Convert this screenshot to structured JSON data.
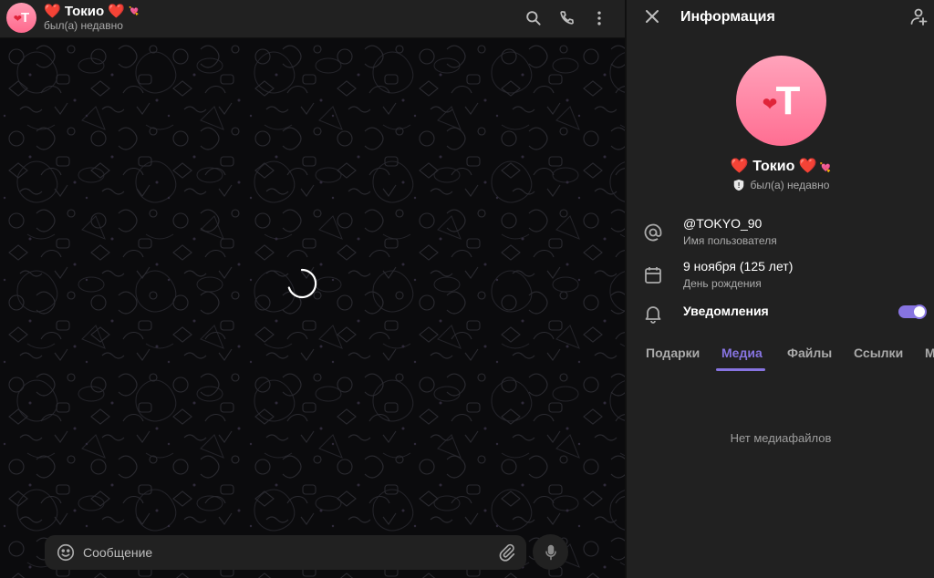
{
  "chat": {
    "avatar_letter": "T",
    "title_prefix": "❤️",
    "title": "Токио",
    "title_suffix": "❤️",
    "title_extra": "💘",
    "status": "был(а) недавно",
    "composer_placeholder": "Сообщение"
  },
  "panel": {
    "title": "Информация",
    "avatar_letter": "T",
    "name_prefix": "❤️",
    "name": "Токио",
    "name_suffix": "❤️",
    "name_extra": "💘",
    "status": "был(а) недавно",
    "username": "@TOKYO_90",
    "username_label": "Имя пользователя",
    "birthday": "9 ноября (125 лет)",
    "birthday_label": "День рождения",
    "notifications_label": "Уведомления",
    "notifications_on": true,
    "tabs": [
      {
        "label": "Подарки",
        "active": false
      },
      {
        "label": "Медиа",
        "active": true
      },
      {
        "label": "Файлы",
        "active": false
      },
      {
        "label": "Ссылки",
        "active": false
      },
      {
        "label": "М",
        "active": false
      }
    ],
    "empty_text": "Нет медиафайлов"
  },
  "icons": {
    "search": "search-icon",
    "call": "phone-icon",
    "more": "more-vertical-icon",
    "close": "close-icon",
    "add_contact": "add-contact-icon",
    "username": "at-icon",
    "birthday": "calendar-icon",
    "notifications": "bell-icon",
    "emoji": "smile-icon",
    "attach": "paperclip-icon",
    "mic": "microphone-icon"
  },
  "colors": {
    "accent": "#8774e1",
    "avatar_gradient_top": "#ff9bb3",
    "avatar_gradient_bottom": "#ff6a8e",
    "heart": "#e0243a",
    "panel_bg": "#212121",
    "chat_bg": "#0e0e10"
  }
}
